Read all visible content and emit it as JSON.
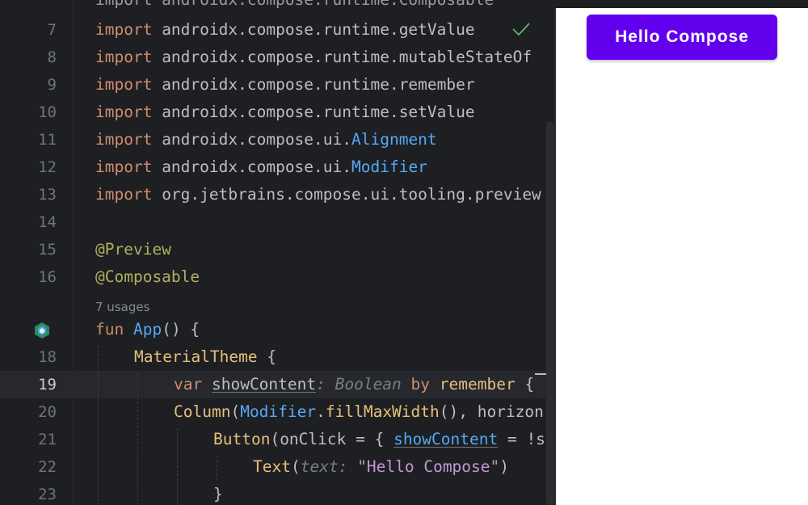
{
  "editor": {
    "partial_top": "import androidx.compose.runtime.Composable",
    "line_numbers": [
      "7",
      "8",
      "9",
      "10",
      "11",
      "12",
      "13",
      "14",
      "15",
      "16",
      "18",
      "19",
      "20",
      "21",
      "22",
      "23"
    ],
    "lines": {
      "l7": {
        "kw": "import",
        "rest": " androidx.compose.runtime.getValue"
      },
      "l8": {
        "kw": "import",
        "rest": " androidx.compose.runtime.mutableStateOf"
      },
      "l9": {
        "kw": "import",
        "rest": " androidx.compose.runtime.remember"
      },
      "l10": {
        "kw": "import",
        "rest": " androidx.compose.runtime.setValue"
      },
      "l11": {
        "kw": "import",
        "rest": " androidx.compose.ui.",
        "cls": "Alignment"
      },
      "l12": {
        "kw": "import",
        "rest": " androidx.compose.ui.",
        "cls": "Modifier"
      },
      "l13": {
        "kw": "import",
        "rest": " org.jetbrains.compose.ui.tooling.preview"
      },
      "l15": {
        "ann": "@Preview"
      },
      "l16": {
        "ann": "@Composable"
      },
      "usages": "7 usages",
      "l17": {
        "kw": "fun",
        "fn": " App",
        "rest": "() {"
      },
      "l18": {
        "call": "MaterialTheme",
        "rest": " {"
      },
      "l19": {
        "kw": "var",
        "prop": "showContent",
        "hint": ": Boolean",
        "kw2": " by",
        "call": " remember",
        "rest": " {"
      },
      "l20": {
        "call": "Column",
        "p1": "(",
        "cls": "Modifier",
        "p2": ".",
        "call2": "fillMaxWidth",
        "rest": "(), horizon"
      },
      "l21": {
        "call": "Button",
        "p1": "(onClick = { ",
        "prop": "showContent",
        "rest": " = !s"
      },
      "l22": {
        "call": "Text",
        "p1": "(",
        "hint": "text:",
        "str": " \"Hello Compose\"",
        "rest": ")"
      },
      "l23": {
        "rest": "}"
      }
    }
  },
  "preview": {
    "button_label": "Hello Compose",
    "button_color": "#6200ee"
  },
  "colors": {
    "keyword": "#cf8e6d",
    "annotation": "#b3ae60",
    "function": "#56a8f5",
    "string": "#c596d4"
  }
}
